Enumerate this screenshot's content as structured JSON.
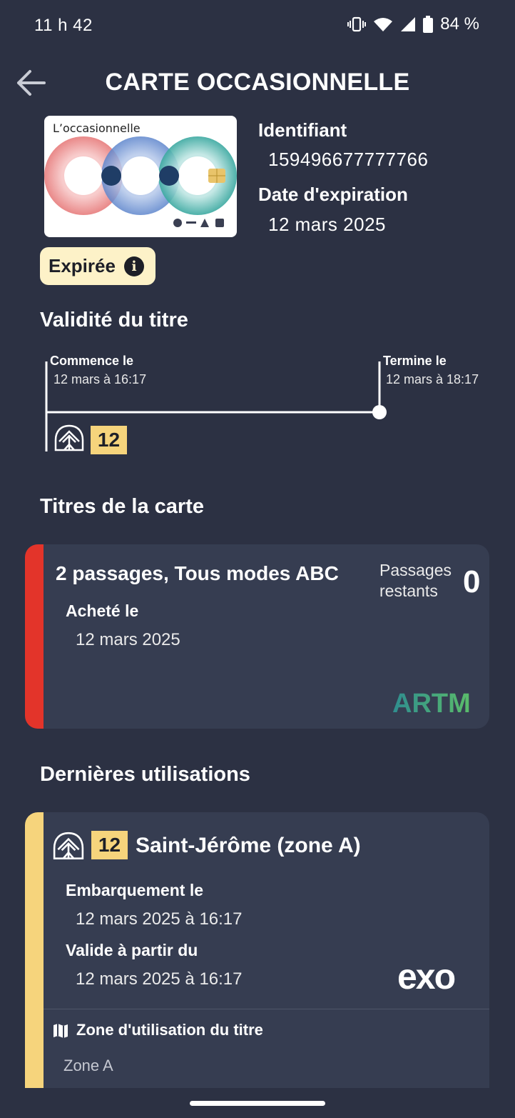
{
  "status_bar": {
    "time": "11 h 42",
    "battery": "84 %"
  },
  "header": {
    "title": "CARTE OCCASIONNELLE"
  },
  "card": {
    "brand": "L’occasionnelle",
    "id_label": "Identifiant",
    "id_value": "159496677777766",
    "expiry_label": "Date d'expiration",
    "expiry_value": "12 mars 2025",
    "status_badge": "Expirée"
  },
  "validity": {
    "section_title": "Validité du titre",
    "start_label": "Commence le",
    "start_value": "12 mars à 16:17",
    "end_label": "Termine le",
    "end_value": "12 mars à 18:17",
    "line_number": "12"
  },
  "titles": {
    "section_title": "Titres de la carte",
    "item": {
      "name": "2 passages, Tous modes ABC",
      "remaining_label_1": "Passages",
      "remaining_label_2": "restants",
      "remaining_value": "0",
      "bought_label": "Acheté le",
      "bought_value": "12 mars 2025",
      "operator_logo": "ARTM"
    }
  },
  "usages": {
    "section_title": "Dernières utilisations",
    "item": {
      "line_number": "12",
      "station": "Saint-Jérôme (zone A)",
      "boarding_label": "Embarquement le",
      "boarding_value": "12 mars 2025 à 16:17",
      "valid_label": "Valide à partir du",
      "valid_value": "12 mars 2025 à 16:17",
      "operator_logo": "exo",
      "zone_label": "Zone d'utilisation du titre",
      "zone_value": "Zone A"
    }
  },
  "colors": {
    "background": "#2c3143",
    "card_bg": "#363d51",
    "expired_stripe": "#e3342a",
    "train_line_yellow": "#f6d47c",
    "badge_bg": "#fdf2c8"
  }
}
